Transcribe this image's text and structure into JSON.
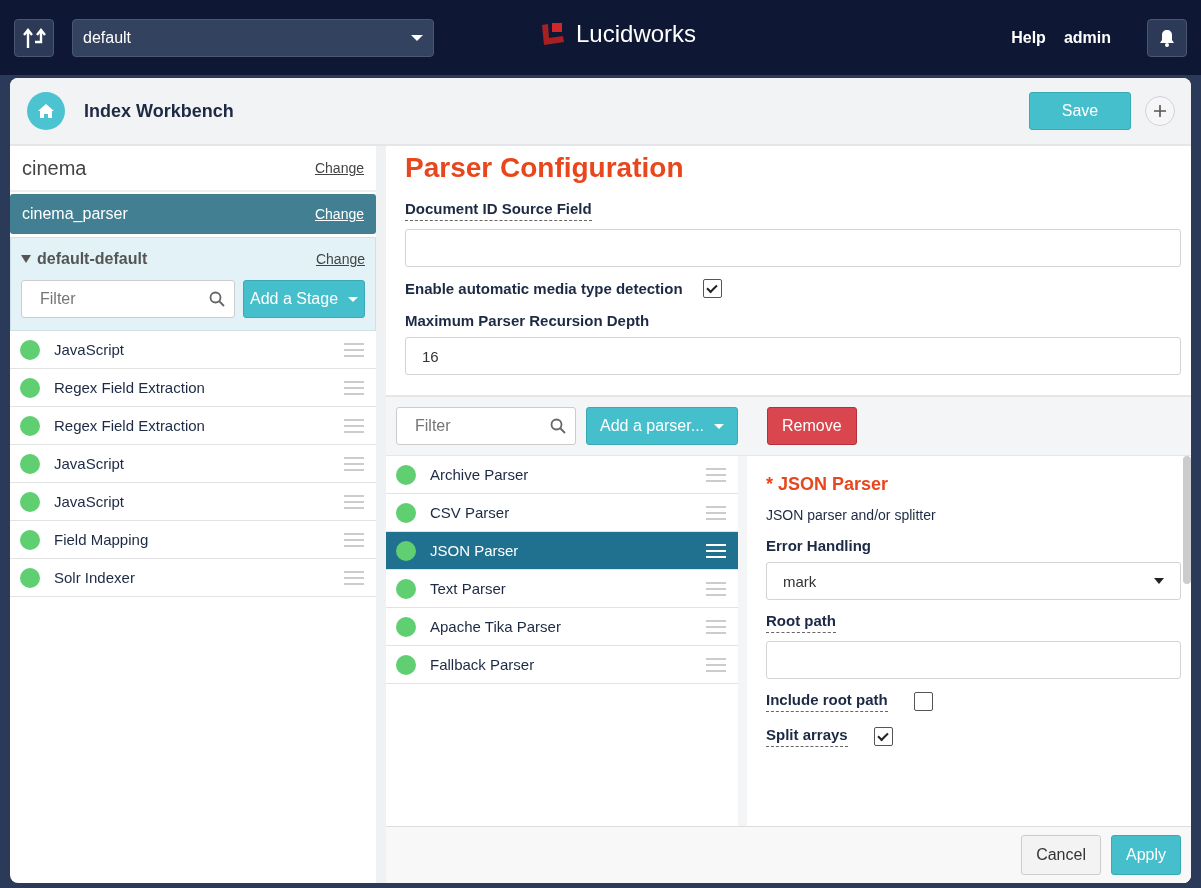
{
  "topbar": {
    "app_select": "default",
    "logo": "Lucidworks",
    "links": [
      "Help",
      "admin"
    ]
  },
  "header": {
    "title": "Index Workbench",
    "save": "Save"
  },
  "sidebar": {
    "collection": {
      "name": "cinema",
      "change": "Change"
    },
    "parser": {
      "name": "cinema_parser",
      "change": "Change"
    },
    "pipeline": {
      "name": "default-default",
      "change": "Change",
      "expanded": true
    },
    "filter": {
      "placeholder": "Filter"
    },
    "add_stage": "Add a Stage",
    "stages": [
      {
        "name": "JavaScript"
      },
      {
        "name": "Regex Field Extraction"
      },
      {
        "name": "Regex Field Extraction"
      },
      {
        "name": "JavaScript"
      },
      {
        "name": "JavaScript"
      },
      {
        "name": "Field Mapping"
      },
      {
        "name": "Solr Indexer"
      }
    ]
  },
  "config": {
    "title": "Parser Configuration",
    "doc_id_label": "Document ID Source Field",
    "auto_detect": {
      "label": "Enable automatic media type detection",
      "checked": true
    },
    "depth_label": "Maximum Parser Recursion Depth",
    "depth_value": "16"
  },
  "parsers": {
    "filter": {
      "placeholder": "Filter"
    },
    "add": "Add a parser...",
    "remove": "Remove",
    "items": [
      {
        "name": "Archive Parser",
        "selected": false
      },
      {
        "name": "CSV Parser",
        "selected": false
      },
      {
        "name": "JSON Parser",
        "selected": true
      },
      {
        "name": "Text Parser",
        "selected": false
      },
      {
        "name": "Apache Tika Parser",
        "selected": false
      },
      {
        "name": "Fallback Parser",
        "selected": false
      }
    ]
  },
  "detail": {
    "title": "* JSON Parser",
    "description": "JSON parser and/or splitter",
    "error_label": "Error Handling",
    "error_value": "mark",
    "root_label": "Root path",
    "options": [
      {
        "label": "Include root path",
        "checked": false
      },
      {
        "label": "Split arrays",
        "checked": true
      }
    ]
  },
  "footer": {
    "cancel": "Cancel",
    "apply": "Apply"
  }
}
